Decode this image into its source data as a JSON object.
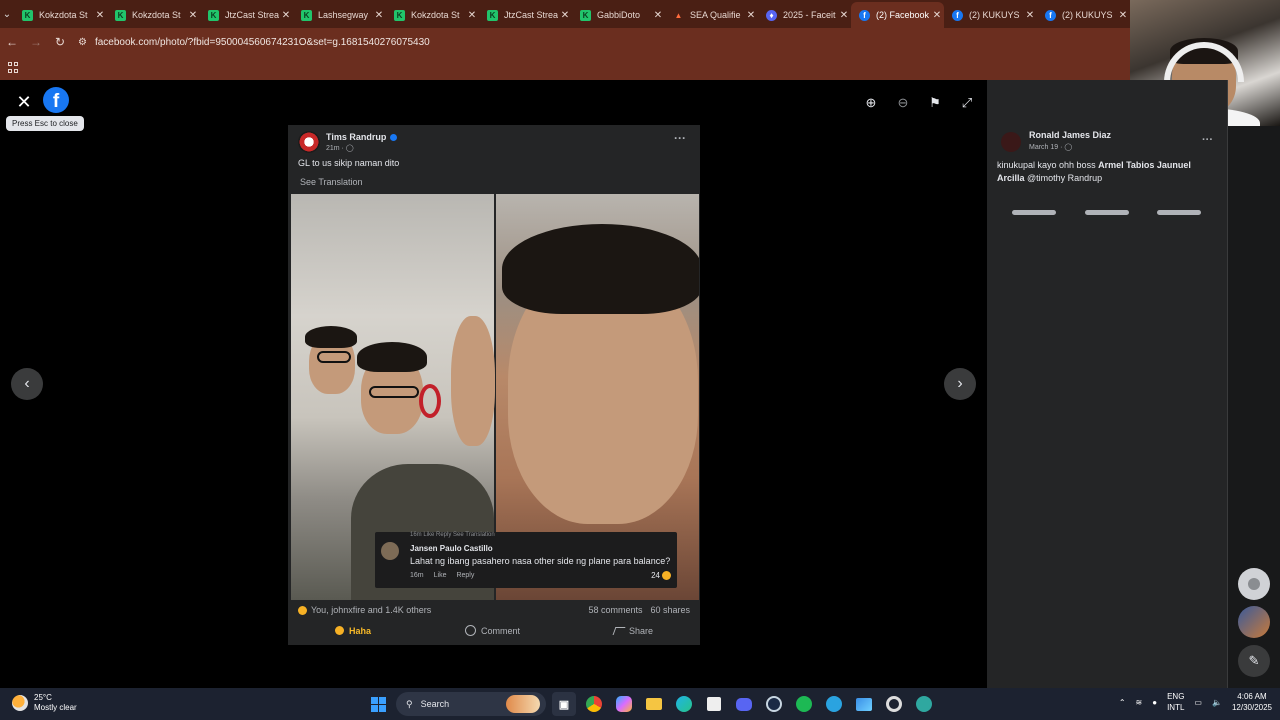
{
  "browser": {
    "tabs": [
      {
        "title": "Kokzdota St",
        "favicon": "kick-icon",
        "active": false
      },
      {
        "title": "Kokzdota St",
        "favicon": "kick-icon",
        "active": false
      },
      {
        "title": "JtzCast Strea",
        "favicon": "kick-icon",
        "active": false
      },
      {
        "title": "Lashsegway",
        "favicon": "kick-icon",
        "active": false
      },
      {
        "title": "Kokzdota St",
        "favicon": "kick-icon",
        "active": false
      },
      {
        "title": "JtzCast Strea",
        "favicon": "kick-icon",
        "active": false
      },
      {
        "title": "GabbiDoto",
        "favicon": "kick-icon",
        "active": false
      },
      {
        "title": "SEA Qualifie",
        "favicon": "sea-icon",
        "active": false
      },
      {
        "title": "2025 - Faceit",
        "favicon": "discord-shield-icon",
        "active": false
      },
      {
        "title": "(2) Facebook",
        "favicon": "facebook-icon",
        "active": true
      },
      {
        "title": "(2) KUKUYS",
        "favicon": "facebook-icon",
        "active": false
      },
      {
        "title": "(2) KUKUYS",
        "favicon": "facebook-icon",
        "active": false
      }
    ],
    "url": "facebook.com/photo/?fbid=950004560674231O&set=g.1681540276075430"
  },
  "viewer": {
    "tooltip": "Press Esc to close",
    "post": {
      "author": "Tims Randrup",
      "meta": "21m ·",
      "text": "GL to us sikip naman dito",
      "see_translation": "See Translation",
      "overlay_comment": {
        "previous_meta": "16m   Like   Reply   See Translation",
        "name": "Jansen Paulo Castillo",
        "text": "Lahat ng ibang pasahero nasa other side ng plane para balance?",
        "time": "16m",
        "like": "Like",
        "reply": "Reply",
        "reactions": "24"
      },
      "reactions_text": "You, johnxfire and 1.4K others",
      "comments": "58 comments",
      "shares": "60 shares",
      "actions": {
        "haha": "Haha",
        "comment": "Comment",
        "share": "Share"
      }
    }
  },
  "side": {
    "name": "Ronald James Diaz",
    "date": "March 19 ·",
    "caption_pre": "kinukupal kayo ohh boss ",
    "caption_bold": "Armel Tabios Jaunuel Arcilla",
    "caption_post": " @timothy Randrup"
  },
  "taskbar": {
    "temp": "25°C",
    "weather": "Mostly clear",
    "search": "Search",
    "lang1": "ENG",
    "lang2": "INTL",
    "time": "4:06 AM",
    "date": "12/30/2025"
  }
}
